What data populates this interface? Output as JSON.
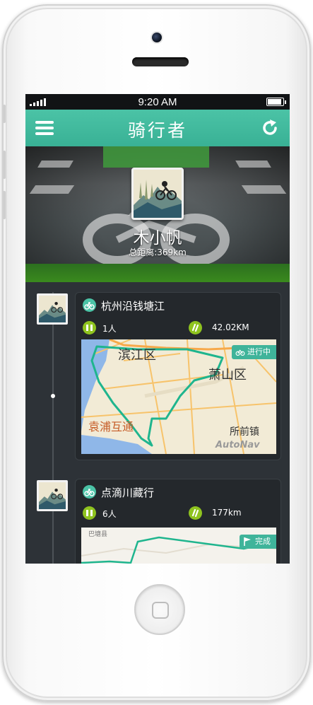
{
  "status_bar": {
    "time": "9:20 AM"
  },
  "navbar": {
    "title": "骑行者",
    "menu_icon": "menu-icon",
    "refresh_icon": "refresh-icon"
  },
  "profile": {
    "name": "木小帆",
    "distance": "总距离:369km"
  },
  "rides": [
    {
      "title": "杭州沿钱塘江",
      "people": "1人",
      "distance": "42.02KM",
      "status": "进行中",
      "status_icon": "bike-icon",
      "map_labels": {
        "a": "滨江区",
        "b": "萧山区",
        "c": "袁浦互通",
        "d": "所前镇",
        "brand": "AutoNav"
      }
    },
    {
      "title": "点滴川藏行",
      "people": "6人",
      "distance": "177km",
      "status": "完成",
      "status_icon": "flag-icon",
      "map_labels": {
        "a": "巴塘县"
      }
    }
  ],
  "colors": {
    "accent": "#4bc3a6",
    "stat_green": "#8fc31f",
    "route": "#1fb58e"
  }
}
